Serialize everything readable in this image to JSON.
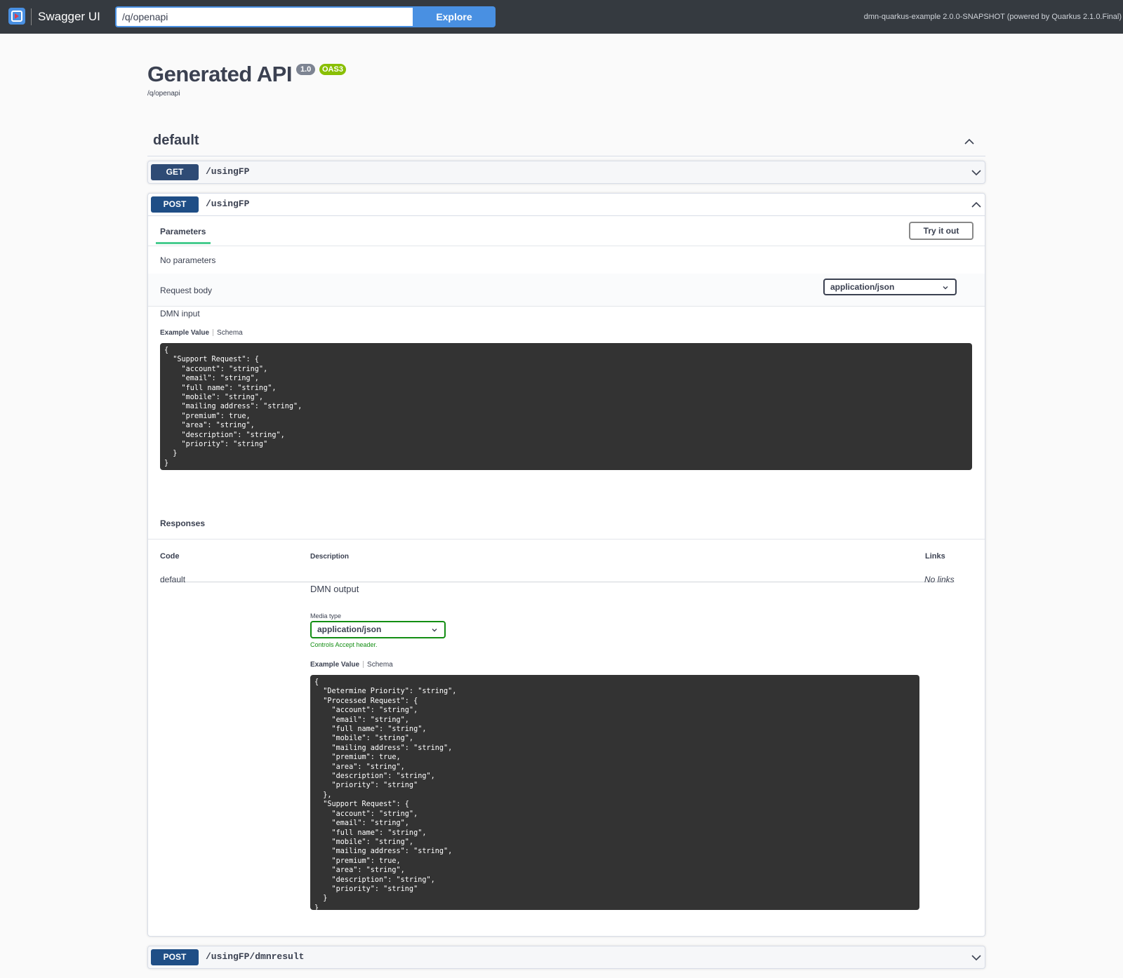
{
  "topbar": {
    "brand": "Swagger UI",
    "url_value": "/q/openapi",
    "explore_label": "Explore",
    "version_text": "dmn-quarkus-example 2.0.0-SNAPSHOT (powered by Quarkus 2.1.0.Final)"
  },
  "info": {
    "title": "Generated API",
    "version_badge": "1.0",
    "oas_badge": "OAS3",
    "url": "/q/openapi"
  },
  "tag": {
    "name": "default"
  },
  "operations": [
    {
      "method": "GET",
      "path": "/usingFP"
    },
    {
      "method": "POST",
      "path": "/usingFP"
    },
    {
      "method": "POST",
      "path": "/usingFP/dmnresult"
    }
  ],
  "post_open": {
    "parameters_tab": "Parameters",
    "try_label": "Try it out",
    "no_params": "No parameters",
    "request_body_label": "Request body",
    "request_content_type": "application/json",
    "body_description": "DMN input",
    "example_value_tab": "Example Value",
    "schema_tab": "Schema",
    "request_example": "{\n  \"Support Request\": {\n    \"account\": \"string\",\n    \"email\": \"string\",\n    \"full name\": \"string\",\n    \"mobile\": \"string\",\n    \"mailing address\": \"string\",\n    \"premium\": true,\n    \"area\": \"string\",\n    \"description\": \"string\",\n    \"priority\": \"string\"\n  }\n}",
    "responses_title": "Responses",
    "col_code": "Code",
    "col_description": "Description",
    "col_links": "Links",
    "response_code": "default",
    "response_description": "DMN output",
    "no_links": "No links",
    "media_type_label": "Media type",
    "media_type_value": "application/json",
    "controls_accept": "Controls Accept header.",
    "response_example": "{\n  \"Determine Priority\": \"string\",\n  \"Processed Request\": {\n    \"account\": \"string\",\n    \"email\": \"string\",\n    \"full name\": \"string\",\n    \"mobile\": \"string\",\n    \"mailing address\": \"string\",\n    \"premium\": true,\n    \"area\": \"string\",\n    \"description\": \"string\",\n    \"priority\": \"string\"\n  },\n  \"Support Request\": {\n    \"account\": \"string\",\n    \"email\": \"string\",\n    \"full name\": \"string\",\n    \"mobile\": \"string\",\n    \"mailing address\": \"string\",\n    \"premium\": true,\n    \"area\": \"string\",\n    \"description\": \"string\",\n    \"priority\": \"string\"\n  }\n}"
  },
  "colors": {
    "topbar": "#353a40",
    "accent": "#4990e2",
    "get": "#2e4b75",
    "post": "#1f4e86",
    "oas_badge": "#89bf04",
    "success": "#138e13"
  }
}
